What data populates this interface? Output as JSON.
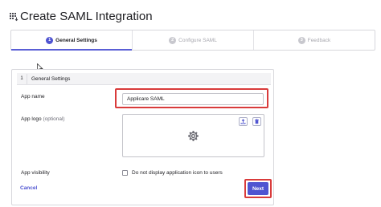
{
  "header": {
    "title": "Create SAML Integration",
    "icon": "app-grid-icon"
  },
  "stepper": {
    "steps": [
      {
        "number": "1",
        "label": "General Settings",
        "active": true
      },
      {
        "number": "2",
        "label": "Configure SAML",
        "active": false
      },
      {
        "number": "3",
        "label": "Feedback",
        "active": false
      }
    ]
  },
  "form": {
    "section_number": "1",
    "section_title": "General Settings",
    "app_name_label": "App name",
    "app_name_value": "Applicare SAML",
    "app_logo_label": "App logo",
    "app_logo_optional": "(optional)",
    "app_visibility_label": "App visibility",
    "visibility_checkbox_label": "Do not display application icon to users",
    "visibility_checked": false,
    "cancel_label": "Cancel",
    "next_label": "Next"
  },
  "colors": {
    "accent": "#4f54d1",
    "highlight": "#d93b3b"
  }
}
